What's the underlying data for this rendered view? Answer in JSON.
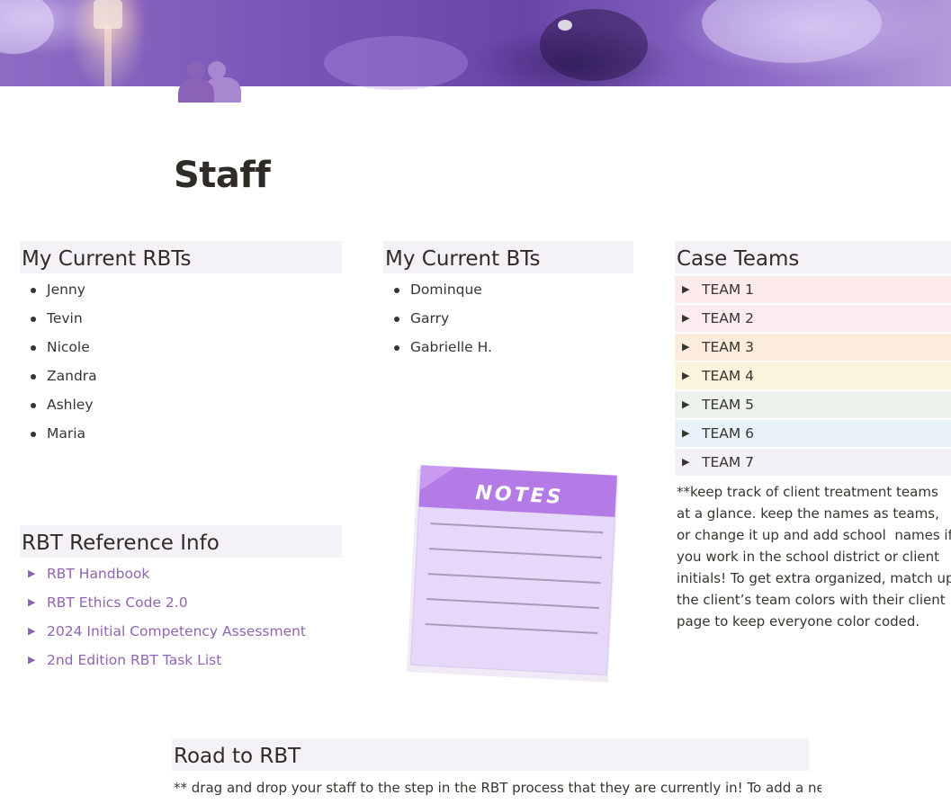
{
  "page": {
    "title": "Staff",
    "icon": "people-icon"
  },
  "rbts": {
    "heading": "My Current RBTs",
    "items": [
      "Jenny",
      "Tevin",
      "Nicole",
      "Zandra",
      "Ashley",
      "Maria"
    ]
  },
  "bts": {
    "heading": "My Current BTs",
    "items": [
      "Dominque",
      "Garry",
      "Gabrielle H."
    ]
  },
  "case_teams": {
    "heading": "Case Teams",
    "teams": [
      {
        "label": "TEAM 1",
        "color": "#fdebec"
      },
      {
        "label": "TEAM 2",
        "color": "#fbecef"
      },
      {
        "label": "TEAM 3",
        "color": "#fbecdd"
      },
      {
        "label": "TEAM 4",
        "color": "#fbf3db"
      },
      {
        "label": "TEAM 5",
        "color": "#edf3ec"
      },
      {
        "label": "TEAM 6",
        "color": "#e7f3f8"
      },
      {
        "label": "TEAM 7",
        "color": "#f4f0f7"
      }
    ],
    "note": "**keep track of client treatment teams at a glance. keep the names as teams, or change it up and add school  names if you work in the school district or client initials! To get extra organized, match up the client’s team colors with their client page to keep everyone color coded."
  },
  "reference": {
    "heading": "RBT Reference Info",
    "items": [
      "RBT Handbook",
      "RBT Ethics Code 2.0",
      "2024 Initial Competency Assessment",
      "2nd Edition RBT Task List"
    ]
  },
  "notes_sticker": {
    "label": "NOTES"
  },
  "road": {
    "heading": "Road to RBT",
    "text": "** drag and drop your staff to the step in the RBT process that they are currently in!  To add a new"
  },
  "colors": {
    "accent": "#9065b0",
    "heading_bg": "#f4f2f7"
  }
}
